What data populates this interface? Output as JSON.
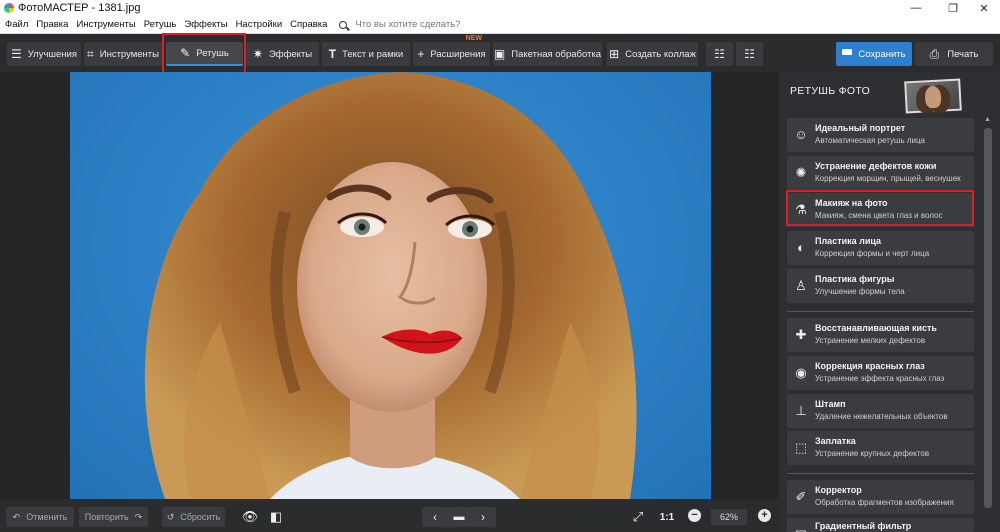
{
  "window": {
    "title": "ФотоМАСТЕР - 1381.jpg",
    "minimize": "—",
    "maximize": "❐",
    "close": "✕"
  },
  "menu": {
    "items": [
      "Файл",
      "Правка",
      "Инструменты",
      "Ретушь",
      "Эффекты",
      "Настройки",
      "Справка"
    ],
    "search_placeholder": "Что вы хотите сделать?"
  },
  "toolbar": {
    "tabs": [
      {
        "label": "Улучшения",
        "icon": "sliders-icon"
      },
      {
        "label": "Инструменты",
        "icon": "crop-icon"
      },
      {
        "label": "Ретушь",
        "icon": "brush-icon"
      },
      {
        "label": "Эффекты",
        "icon": "sparkle-icon"
      },
      {
        "label": "Текст и рамки",
        "icon": "text-icon"
      },
      {
        "label": "Расширения",
        "icon": "plus-icon",
        "badge": "NEW"
      },
      {
        "label": "Пакетная обработка",
        "icon": "image-stack-icon"
      },
      {
        "label": "Создать коллаж",
        "icon": "collage-icon"
      }
    ],
    "active_tab": "Ретушь",
    "save_label": "Сохранить",
    "print_label": "Печать"
  },
  "panel": {
    "title": "РЕТУШЬ ФОТО",
    "items": [
      {
        "name": "Идеальный портрет",
        "desc": "Автоматическая ретушь лица",
        "icon": "portrait-icon"
      },
      {
        "name": "Устранение дефектов кожи",
        "desc": "Коррекция морщин, прыщей, веснушек",
        "icon": "skin-icon"
      },
      {
        "name": "Макияж на фото",
        "desc": "Макияж, смена цвета глаз и волос",
        "icon": "makeup-icon"
      },
      {
        "name": "Пластика лица",
        "desc": "Коррекция формы и черт лица",
        "icon": "face-shape-icon"
      },
      {
        "name": "Пластика фигуры",
        "desc": "Улучшение формы тела",
        "icon": "figure-icon"
      },
      {
        "name": "Восстанавливающая кисть",
        "desc": "Устранение мелких дефектов",
        "icon": "bandage-icon"
      },
      {
        "name": "Коррекция красных глаз",
        "desc": "Устранение эффекта красных глаз",
        "icon": "eye-icon"
      },
      {
        "name": "Штамп",
        "desc": "Удаление нежелательных объектов",
        "icon": "stamp-icon"
      },
      {
        "name": "Заплатка",
        "desc": "Устранение крупных дефектов",
        "icon": "patch-icon"
      },
      {
        "name": "Корректор",
        "desc": "Обработка фрагментов изображения",
        "icon": "corrector-icon"
      },
      {
        "name": "Градиентный фильтр",
        "desc": "",
        "icon": "gradient-icon"
      }
    ],
    "highlighted_item": "Макияж на фото"
  },
  "bottom": {
    "undo_label": "Отменить",
    "redo_label": "Повторить",
    "reset_label": "Сбросить",
    "ratio_label": "1:1",
    "zoom_value": "62%"
  },
  "colors": {
    "accent": "#2d7fd0",
    "highlight": "#d8202a",
    "background": "#2b2c2e",
    "photo_background": "#2f83c8"
  }
}
